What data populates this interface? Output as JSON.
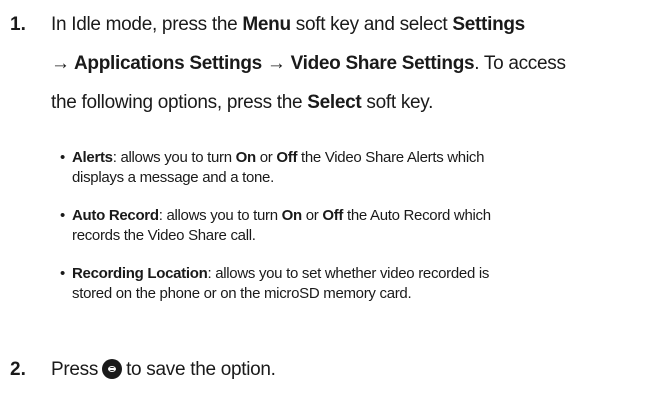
{
  "step1": {
    "number": "1.",
    "line1": {
      "t1": "In Idle mode, press the ",
      "b1": "Menu",
      "t2": " soft key and select ",
      "b2": "Settings"
    },
    "line2": {
      "b1": "→ Applications Settings → Video Share Settings",
      "t1": ". To access"
    },
    "line3": {
      "t1": "the following options, press the ",
      "b1": "Select",
      "t2": " soft key."
    }
  },
  "bullets": [
    {
      "dot": "•",
      "line1": {
        "b1": "Alerts",
        "t1": ": allows you to turn ",
        "b2": "On",
        "t2": " or ",
        "b3": "Off",
        "t3": " the Video Share Alerts which"
      },
      "line2": "displays a message and a tone."
    },
    {
      "dot": "•",
      "line1": {
        "b1": "Auto Record",
        "t1": ": allows you to turn ",
        "b2": "On",
        "t2": " or ",
        "b3": "Off",
        "t3": " the Auto Record which"
      },
      "line2": "records the Video Share call."
    },
    {
      "dot": "•",
      "line1": {
        "b1": "Recording Location",
        "t1": ": allows you to set whether video recorded is"
      },
      "line2": "stored on the phone or on the microSD memory card."
    }
  ],
  "step2": {
    "number": "2.",
    "t1": "Press",
    "icon": "center-key-icon",
    "t2": "to save the option."
  }
}
